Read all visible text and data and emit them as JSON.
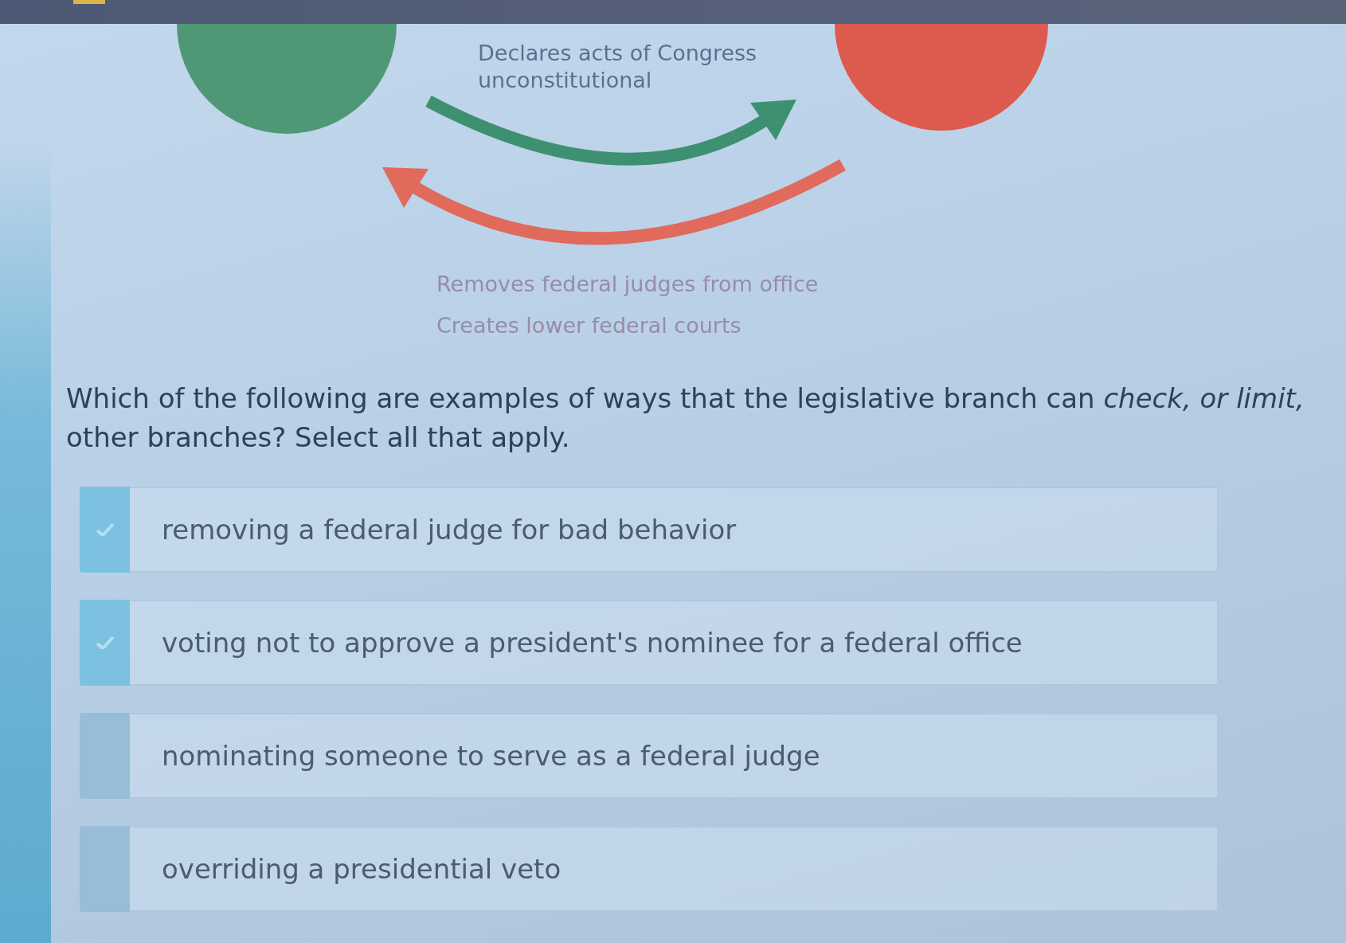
{
  "diagram": {
    "branches": [
      {
        "color": "#4f9876"
      },
      {
        "color": "#dc5a4e"
      }
    ],
    "arrows": [
      {
        "color": "#3d9070",
        "labels": [
          "Declares acts of Congress unconstitutional"
        ]
      },
      {
        "color": "#e06a5c",
        "labels": [
          "Removes federal judges from office",
          "Creates lower federal courts"
        ]
      }
    ]
  },
  "question": "Which of the following are examples of ways that the legislative branch can *check, or limit,* other branches? Select all that apply.",
  "options": [
    {
      "label": "removing a federal judge for bad behavior",
      "checked": true
    },
    {
      "label": "voting not to approve a president's nominee for a federal office",
      "checked": true
    },
    {
      "label": "nominating someone to serve as a federal judge",
      "checked": false
    },
    {
      "label": "overriding a presidential veto",
      "checked": false
    }
  ]
}
